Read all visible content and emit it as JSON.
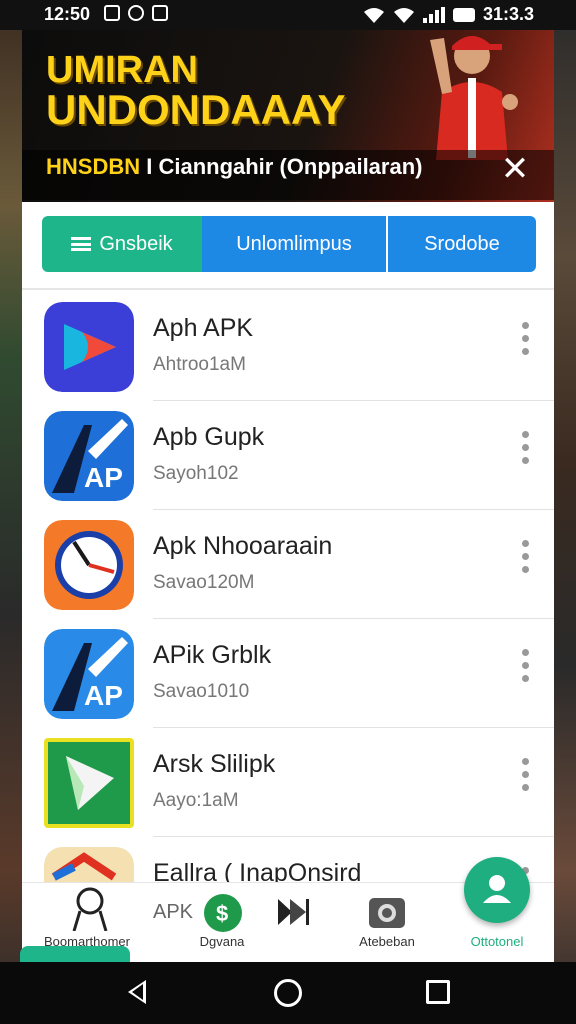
{
  "status_bar": {
    "time": "12:50",
    "battery_text": "31:3.3",
    "left_icons": [
      "message-icon",
      "location-icon",
      "app-icon"
    ],
    "right_icons": [
      "wifi-icon",
      "signal-icon",
      "battery-icon"
    ]
  },
  "banner": {
    "title_line1": "UMIRAN",
    "title_line2": "UNDONDAAAY",
    "subtitle_highlight": "HNSDBN",
    "subtitle_rest": " I Cianngahir (Onppailaran)",
    "close_label": "✕",
    "accent_color": "#ffd21a"
  },
  "tabs": [
    {
      "label": "Gnsbeik",
      "color": "#1fb58a",
      "icon": "list-icon"
    },
    {
      "label": "Unlomlimpus",
      "color": "#1e88e5"
    },
    {
      "label": "Srodobe",
      "color": "#1e88e5"
    }
  ],
  "apps": [
    {
      "name": "Aph APK",
      "subtitle": "Ahtroo1aM",
      "icon": "play-store-icon"
    },
    {
      "name": "Apb Gupk",
      "subtitle": "Sayoh102",
      "icon": "ap-logo-icon"
    },
    {
      "name": "Apk Nhooaraain",
      "subtitle": "Savao120M",
      "icon": "clock-app-icon"
    },
    {
      "name": "APik Grblk",
      "subtitle": "Savao1010",
      "icon": "ap-logo-icon"
    },
    {
      "name": "Arsk Slilipk",
      "subtitle": "Aayo:1aM",
      "icon": "green-play-icon"
    },
    {
      "name": "Eallra ( InapOnsird",
      "subtitle": "APK",
      "icon": "partial-app-icon"
    }
  ],
  "bottom_nav": [
    {
      "label": "Boomarthomer",
      "icon": "person-outline-icon"
    },
    {
      "label": "Dgvana",
      "icon": "dollar-icon"
    },
    {
      "label": "",
      "icon": "play-forward-icon"
    },
    {
      "label": "Atebeban",
      "icon": "camera-icon"
    },
    {
      "label": "Ottotonel",
      "icon": "user-icon"
    }
  ],
  "colors": {
    "green": "#1fb58a",
    "blue": "#1e88e5"
  }
}
